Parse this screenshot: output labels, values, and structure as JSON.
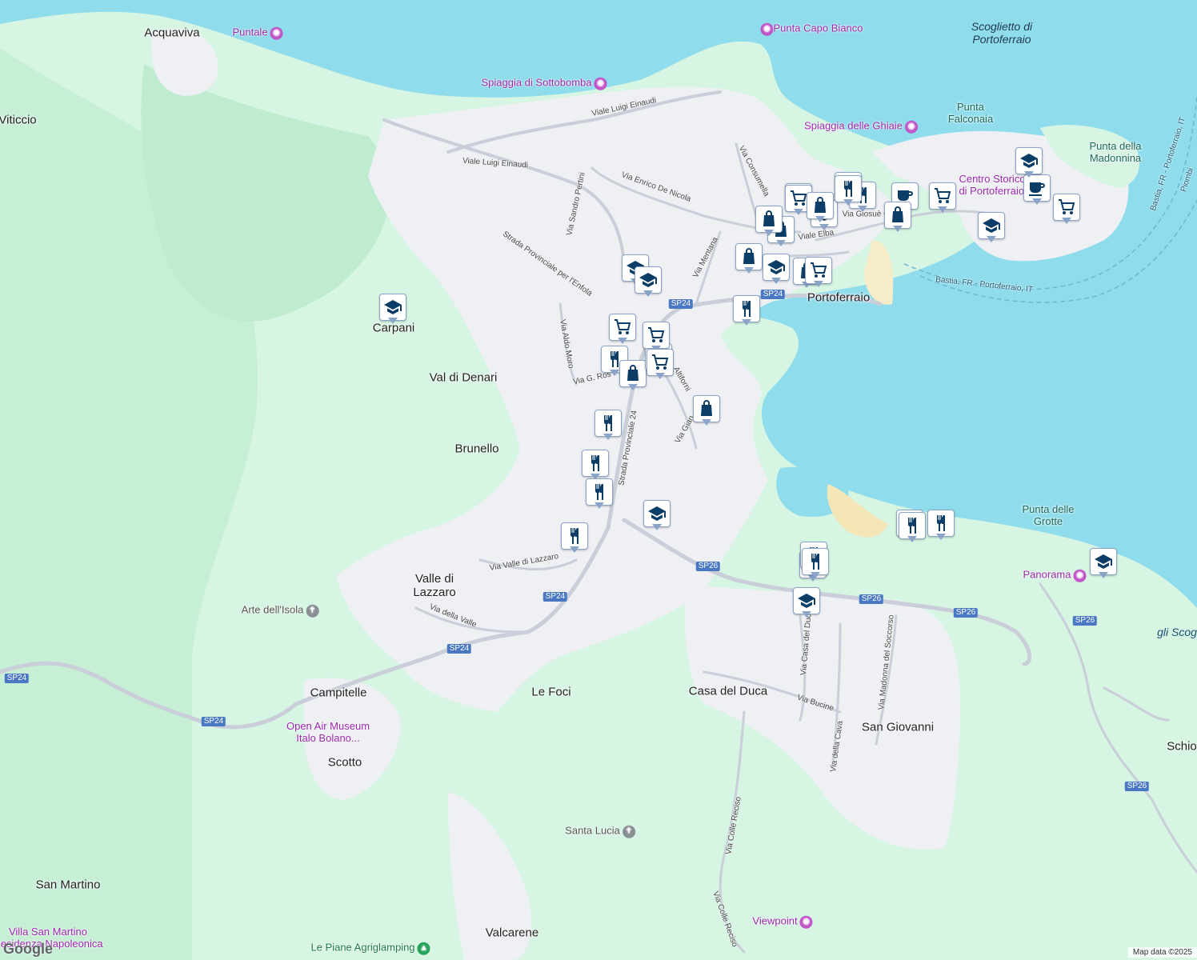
{
  "map": {
    "place_labels": [
      {
        "id": "acquaviva",
        "text": "Acquaviva"
      },
      {
        "id": "viticcio",
        "text": "Viticcio"
      },
      {
        "id": "carpani",
        "text": "Carpani"
      },
      {
        "id": "val-di-denari",
        "text": "Val di Denari"
      },
      {
        "id": "brunello",
        "text": "Brunello"
      },
      {
        "id": "valle-di-lazzaro",
        "text": "Valle di\nLazzaro"
      },
      {
        "id": "campitelle",
        "text": "Campitelle"
      },
      {
        "id": "scotto",
        "text": "Scotto"
      },
      {
        "id": "le-foci",
        "text": "Le Foci"
      },
      {
        "id": "casa-del-duca",
        "text": "Casa del Duca"
      },
      {
        "id": "san-giovanni",
        "text": "San Giovanni"
      },
      {
        "id": "san-martino",
        "text": "San Martino"
      },
      {
        "id": "valcarene",
        "text": "Valcarene"
      },
      {
        "id": "portoferraio",
        "text": "Portoferraio"
      },
      {
        "id": "schio",
        "text": "Schio"
      }
    ],
    "poi_labels": [
      {
        "id": "puntale",
        "text": "Puntale",
        "type": "camera"
      },
      {
        "id": "punta-capo-bianco",
        "text": "Punta Capo Bianco",
        "type": "camera"
      },
      {
        "id": "spiaggia-sottobomba",
        "text": "Spiaggia di Sottobomba",
        "type": "camera"
      },
      {
        "id": "spiaggia-ghiaie",
        "text": "Spiaggia delle Ghiaie",
        "type": "camera"
      },
      {
        "id": "centro-storico",
        "text": "Centro Storico\ndi Portoferraio",
        "type": "camera"
      },
      {
        "id": "panorama",
        "text": "Panorama",
        "type": "camera"
      },
      {
        "id": "viewpoint",
        "text": "Viewpoint",
        "type": "camera"
      },
      {
        "id": "open-air-museum",
        "text": "Open Air Museum\nItalo Bolano...",
        "type": "museum"
      },
      {
        "id": "villa-san-martino",
        "text": "Villa San Martino\nResidenza Napoleonica",
        "type": "museum"
      },
      {
        "id": "arte-dell-isola",
        "text": "Arte dell'Isola",
        "type": "church"
      },
      {
        "id": "santa-lucia",
        "text": "Santa Lucia",
        "type": "church"
      },
      {
        "id": "le-piane",
        "text": "Le Piane Agriglamping",
        "type": "camp"
      }
    ],
    "coast_labels": [
      {
        "id": "scoglietto",
        "text": "Scoglietto di\nPortoferraio"
      },
      {
        "id": "punta-falconaia",
        "text": "Punta\nFalconaia"
      },
      {
        "id": "punta-madonnina",
        "text": "Punta della\nMadonnina"
      },
      {
        "id": "punta-grotte",
        "text": "Punta delle\nGrotte"
      },
      {
        "id": "gli-scog",
        "text": "gli Scog"
      }
    ],
    "street_labels": [
      {
        "id": "viale-einaudi-1",
        "text": "Viale Luigi Einaudi"
      },
      {
        "id": "viale-einaudi-2",
        "text": "Viale Luigi Einaudi"
      },
      {
        "id": "via-pertini",
        "text": "Via Sandro Pertini"
      },
      {
        "id": "via-de-nicola",
        "text": "Via Enrico De Nicola"
      },
      {
        "id": "strada-enfola",
        "text": "Strada Provinciale per l'Enfola"
      },
      {
        "id": "via-consumella",
        "text": "Via Consumella"
      },
      {
        "id": "via-giosue",
        "text": "Via Giosuè C"
      },
      {
        "id": "viale-elba",
        "text": "Viale Elba"
      },
      {
        "id": "via-mentana",
        "text": "Via Mentana"
      },
      {
        "id": "via-aldo-moro",
        "text": "Via Aldo Moro"
      },
      {
        "id": "via-g-ros",
        "text": "Via G. Ros"
      },
      {
        "id": "via-altiforni",
        "text": "Altiforni"
      },
      {
        "id": "via-gian",
        "text": "Via Gian"
      },
      {
        "id": "strada-sp24",
        "text": "Strada Provinciale 24"
      },
      {
        "id": "via-valle-lazzaro",
        "text": "Via Valle di Lazzaro"
      },
      {
        "id": "via-della-valle",
        "text": "Via della Valle"
      },
      {
        "id": "via-casa-del-duca",
        "text": "Via Casa del Duca"
      },
      {
        "id": "via-della-cava",
        "text": "Via della Cava"
      },
      {
        "id": "via-madonna-soccorso",
        "text": "Via Madonna del Soccorso"
      },
      {
        "id": "via-bucine",
        "text": "Via Bucine"
      },
      {
        "id": "via-colle-reciso-1",
        "text": "Via Colle Reciso"
      },
      {
        "id": "via-colle-reciso-2",
        "text": "Via Colle Reciso"
      },
      {
        "id": "ferry-1",
        "text": "Bastia, FR - Portoferraio, IT"
      },
      {
        "id": "ferry-2",
        "text": "Bastia, FR - Portoferraio, IT"
      },
      {
        "id": "ferry-3",
        "text": "Piombi"
      }
    ],
    "route_shields": [
      {
        "id": "sp24-a",
        "text": "SP24"
      },
      {
        "id": "sp24-b",
        "text": "SP24"
      },
      {
        "id": "sp24-c",
        "text": "SP24"
      },
      {
        "id": "sp24-d",
        "text": "SP24"
      },
      {
        "id": "sp24-e",
        "text": "SP24"
      },
      {
        "id": "sp24-f",
        "text": "SP24"
      },
      {
        "id": "sp26-a",
        "text": "SP26"
      },
      {
        "id": "sp26-b",
        "text": "SP26"
      },
      {
        "id": "sp26-c",
        "text": "SP26"
      },
      {
        "id": "sp26-d",
        "text": "SP26"
      },
      {
        "id": "sp26-e",
        "text": "SP26"
      }
    ],
    "markers": [
      "school",
      "restaurant",
      "shopping",
      "restaurant",
      "cart",
      "restaurant",
      "restaurant",
      "cafe",
      "cart",
      "school",
      "cart",
      "shopping",
      "school",
      "cafe",
      "school",
      "cart",
      "shopping",
      "shopping",
      "school",
      "shopping",
      "restaurant",
      "shopping",
      "school",
      "school",
      "cart",
      "cart",
      "cart",
      "restaurant",
      "shopping",
      "cart",
      "shopping",
      "restaurant",
      "restaurant",
      "cart",
      "restaurant",
      "restaurant",
      "restaurant",
      "restaurant",
      "restaurant",
      "restaurant",
      "restaurant",
      "school",
      "school",
      "school"
    ],
    "colors": {
      "land": "#d7f5e3",
      "urban": "#eef0f4",
      "water": "#8fdcec",
      "road": "#c9ced8",
      "marker_icon": "#0b3d66"
    }
  },
  "footer": {
    "logo": "Google",
    "attribution": "Map data ©2025"
  }
}
